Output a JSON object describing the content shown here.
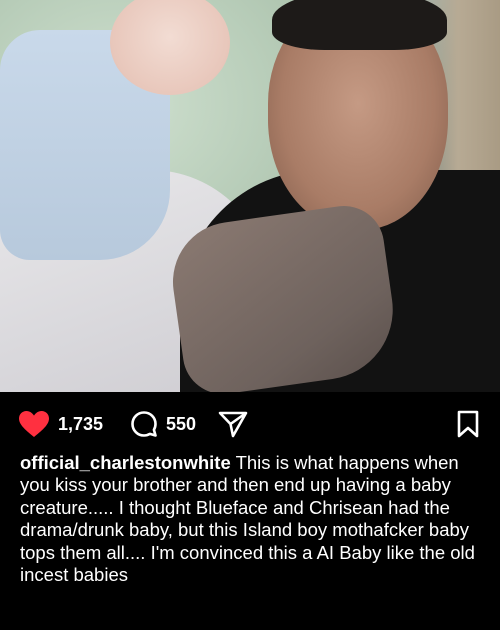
{
  "post": {
    "likes": "1,735",
    "comments": "550",
    "username": "official_charlestonwhite",
    "caption": "This is what happens when you kiss your brother and then end up having a baby creature..... I thought Blueface and Chrisean had the drama/drunk baby, but this Island boy mothafcker baby tops them all.... I'm convinced this a AI Baby like the old incest babies"
  },
  "icons": {
    "like": "heart-icon",
    "comment": "comment-bubble-icon",
    "share": "paper-plane-icon",
    "save": "bookmark-icon"
  },
  "colors": {
    "background": "#000000",
    "heart": "#ff3040",
    "text": "#ffffff"
  }
}
